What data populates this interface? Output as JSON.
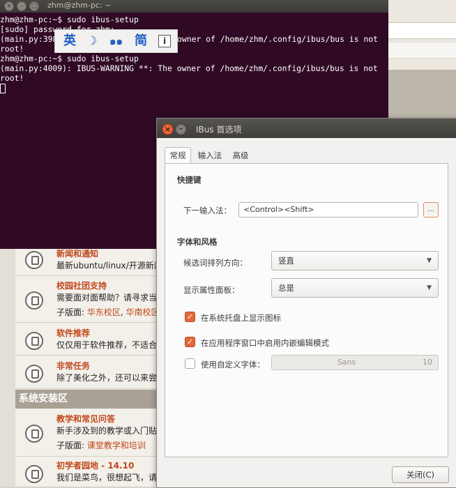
{
  "terminal": {
    "title": "zhm@zhm-pc: ~",
    "lines": [
      "zhm@zhm-pc:~$ sudo ibus-setup",
      "[sudo] password for zhm:",
      "",
      "(main.py:398",
      "root!",
      "zhm@zhm-pc:~$ sudo ibus-setup",
      "",
      "(main.py:4009): IBUS-WARNING **: The owner of /home/zhm/.config/ibus/bus is not",
      "root!"
    ],
    "line3_tail": "owner of /home/zhm/.config/ibus/bus is not"
  },
  "langbar": {
    "chinese_mode": "英",
    "full_half": "☽",
    "punctuation": "๑๑",
    "simplified": "简",
    "info": "i"
  },
  "forum": {
    "section_title": "系统安装区",
    "rows": [
      {
        "title": "新闻和通知",
        "desc": "最新ubuntu/linux/开源新闻"
      },
      {
        "title": "校园社团支持",
        "desc": "需要面对面帮助？请寻求当",
        "sub_prefix": "子版面: ",
        "sub_links": [
          "华东校区",
          "华南校区"
        ]
      },
      {
        "title": "软件推荐",
        "desc": "仅仅用于软件推荐，不适合"
      },
      {
        "title": "非常任务",
        "desc": "除了美化之外，还可以来尝"
      },
      {
        "title": "教学和常见问答",
        "desc": "新手涉及到的教学或入门贴",
        "sub_prefix": "子版面: ",
        "sub_links": [
          "课堂教学和培训"
        ]
      },
      {
        "title": "初学者园地 - 14.10",
        "desc": "我们是菜鸟，很想起飞，请"
      }
    ]
  },
  "dialog": {
    "title": "IBus 首选项",
    "tabs": [
      "常规",
      "输入法",
      "高级"
    ],
    "shortcuts_section": "快捷键",
    "next_engine_label": "下一输入法：",
    "next_engine_value": "<Control><Shift>",
    "dots": "...",
    "font_section": "字体和风格",
    "orientation_label": "候选词排列方向：",
    "orientation_value": "竖直",
    "panel_label": "显示属性面板：",
    "panel_value": "总是",
    "tray_icon_label": "在系统托盘上显示图标",
    "embed_preedit_label": "在应用程序窗口中启用内嵌编辑模式",
    "custom_font_label": "使用自定义字体：",
    "font_name": "Sans",
    "font_size": "10",
    "close_button": "关闭(C)"
  }
}
